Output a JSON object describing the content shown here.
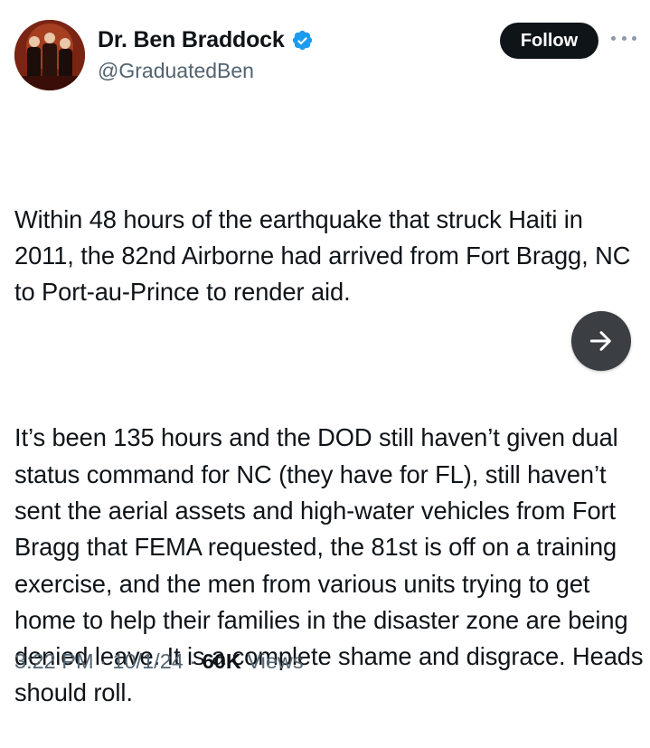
{
  "author": {
    "display_name": "Dr. Ben Braddock",
    "handle": "@GraduatedBen",
    "verified": true,
    "avatar_icon": "profile-photo"
  },
  "actions": {
    "follow_label": "Follow",
    "more_icon": "more-horizontal-icon"
  },
  "tweet": {
    "paragraphs": [
      "Within 48 hours of the earthquake that struck Haiti in 2011, the 82nd Airborne had arrived from Fort Bragg, NC to Port-au-Prince to render aid.",
      "It’s been 135 hours and the DOD still haven’t given dual status command for NC (they have for FL), still haven’t sent the aerial assets and high-water vehicles from Fort Bragg that FEMA requested, the 81st is off on a training exercise, and the men from various units trying to get home to help their families in the disaster zone are being denied leave. It is a complete shame and disgrace. Heads should roll."
    ]
  },
  "overlay": {
    "icon": "arrow-right-icon"
  },
  "meta": {
    "time": "3:22 PM",
    "separator": " · ",
    "date": "10/1/24",
    "views_count": "60K",
    "views_label": " Views"
  },
  "colors": {
    "text_primary": "#0f1419",
    "text_secondary": "#536471",
    "verified_blue": "#1d9bf0",
    "follow_bg": "#0f1419"
  }
}
